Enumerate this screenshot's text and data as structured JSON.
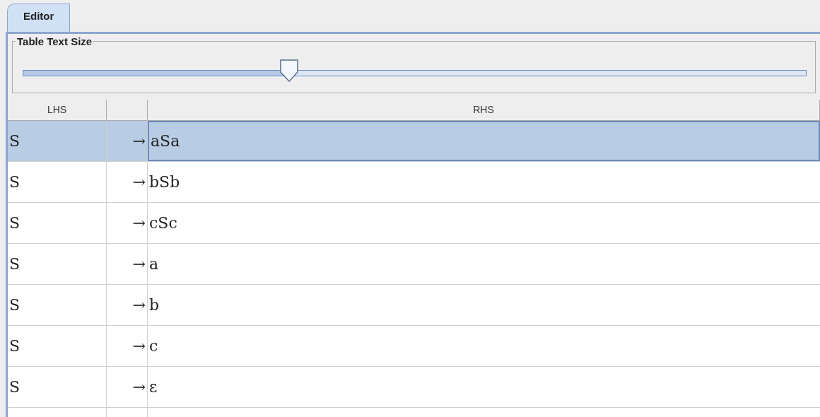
{
  "tabs": [
    {
      "label": "Editor",
      "selected": true
    }
  ],
  "text_size": {
    "title": "Table Text Size",
    "level": 0.34
  },
  "table": {
    "columns": [
      "LHS",
      "",
      "RHS"
    ],
    "rows": [
      {
        "lhs": "S",
        "arrow": "→",
        "rhs": "aSa",
        "selected": true
      },
      {
        "lhs": "S",
        "arrow": "→",
        "rhs": "bSb",
        "selected": false
      },
      {
        "lhs": "S",
        "arrow": "→",
        "rhs": "cSc",
        "selected": false
      },
      {
        "lhs": "S",
        "arrow": "→",
        "rhs": "a",
        "selected": false
      },
      {
        "lhs": "S",
        "arrow": "→",
        "rhs": "b",
        "selected": false
      },
      {
        "lhs": "S",
        "arrow": "→",
        "rhs": "c",
        "selected": false
      },
      {
        "lhs": "S",
        "arrow": "→",
        "rhs": "ε",
        "selected": false
      }
    ]
  }
}
